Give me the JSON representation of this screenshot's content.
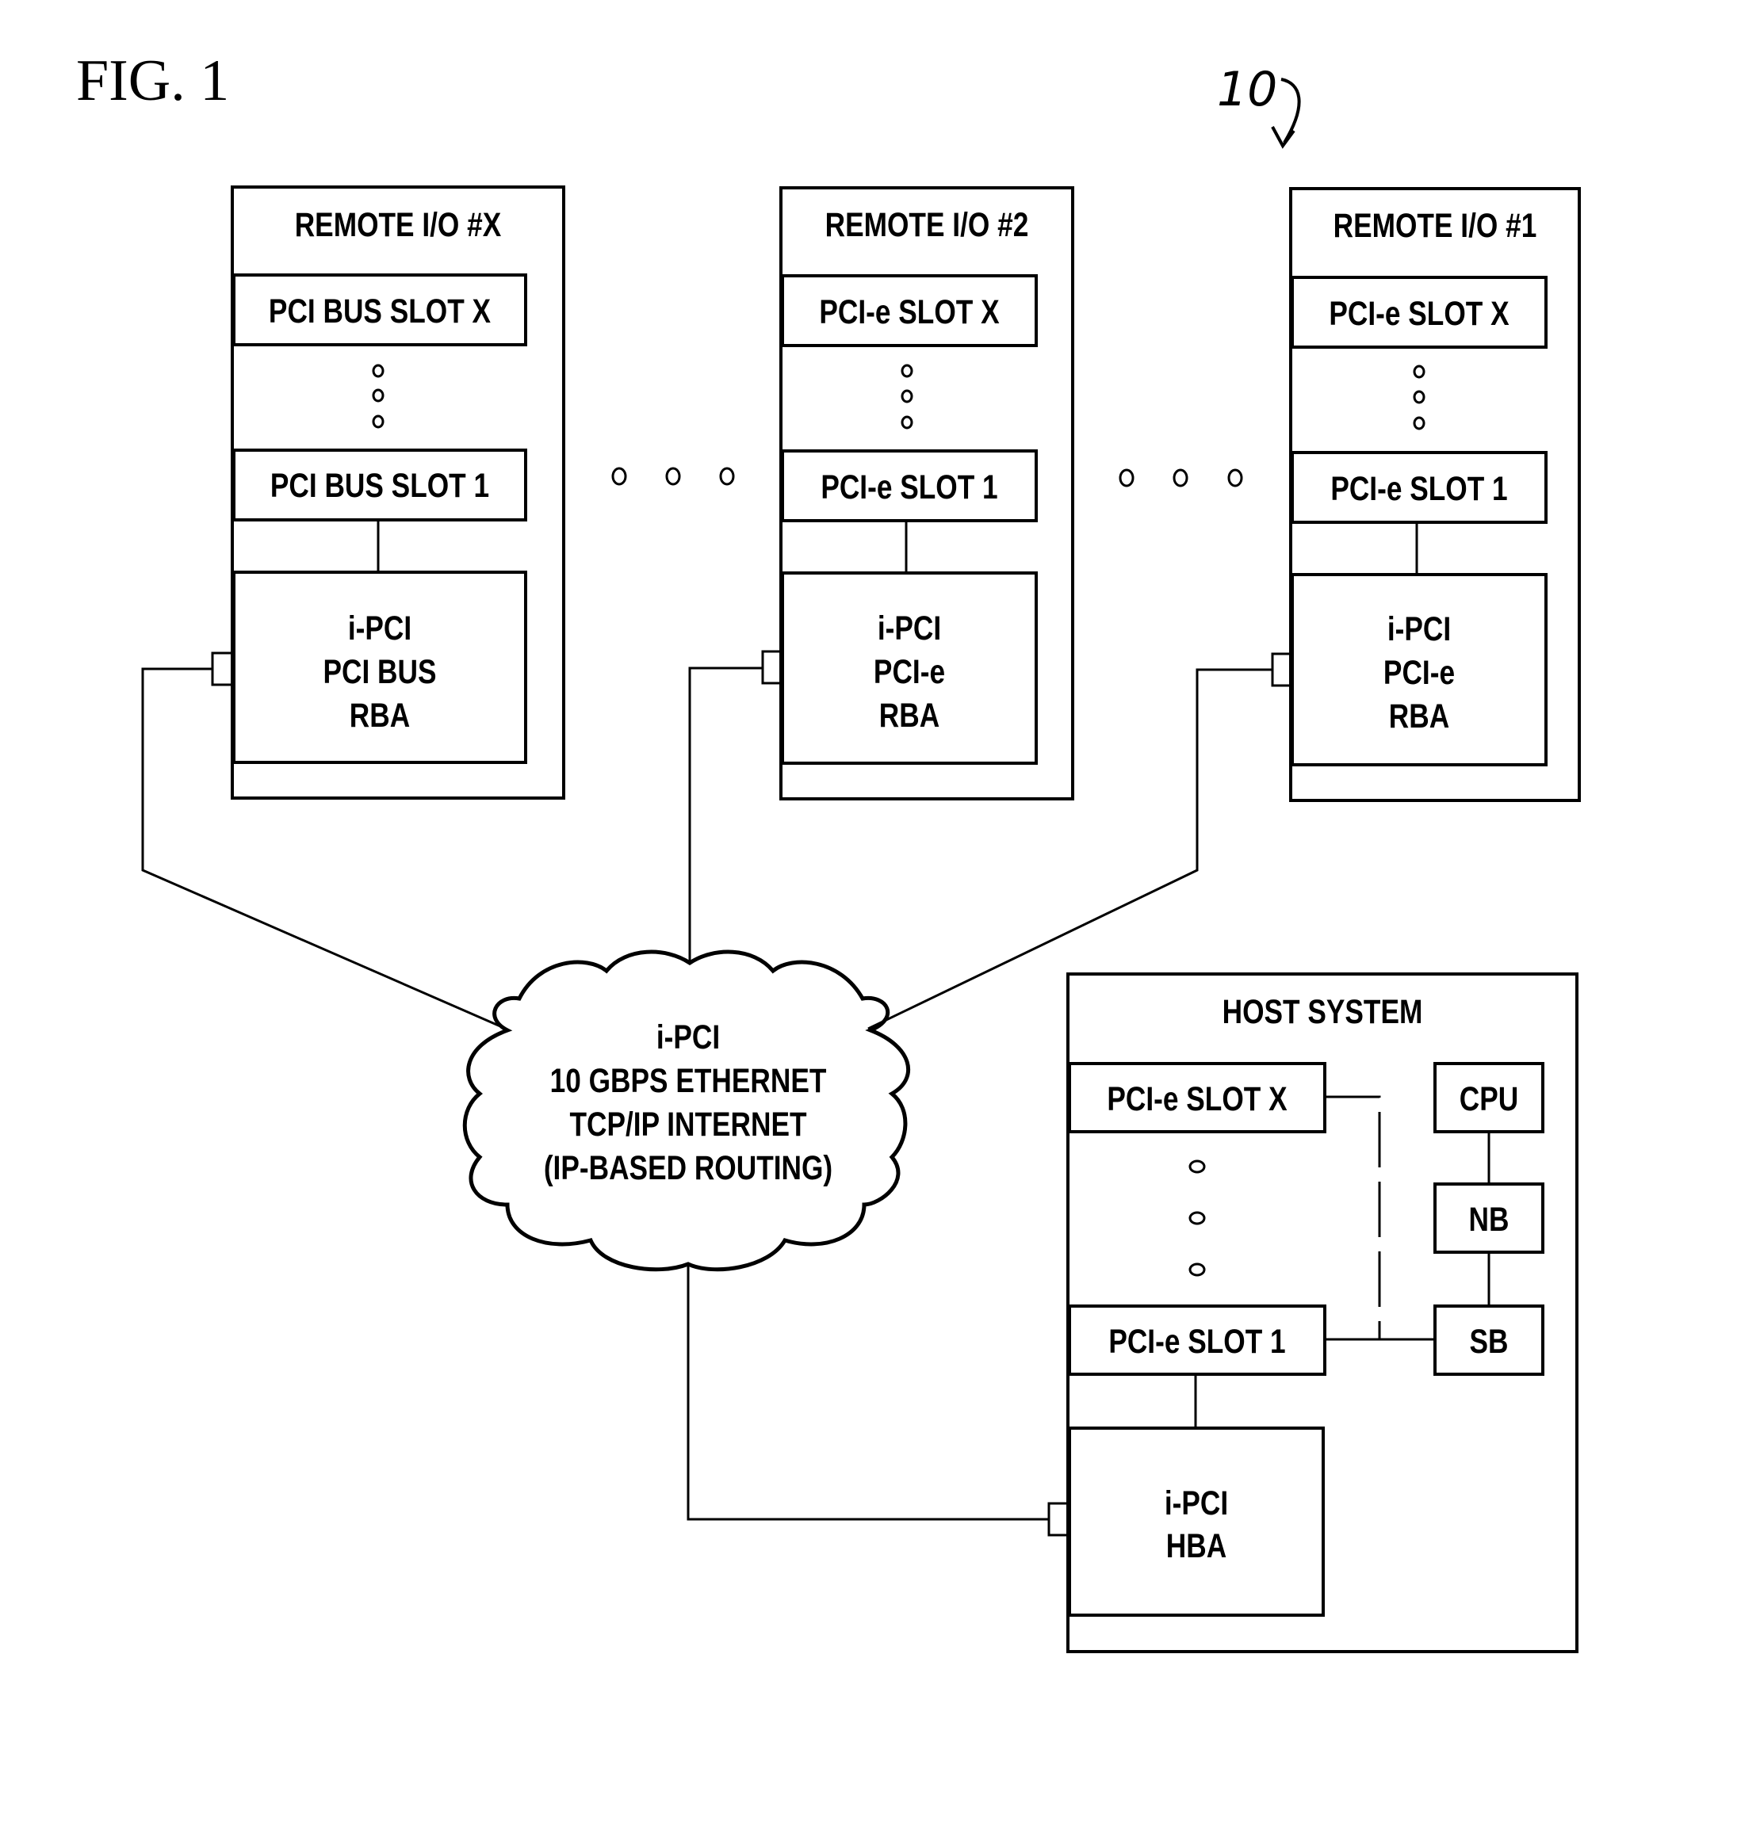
{
  "figure": {
    "label": "FIG. 1",
    "reference_numeral": "10"
  },
  "remote_units": [
    {
      "title": "REMOTE I/O #X",
      "slot_top": "PCI BUS SLOT X",
      "slot_bottom": "PCI BUS SLOT 1",
      "adapter": [
        "i-PCI",
        "PCI BUS",
        "RBA"
      ]
    },
    {
      "title": "REMOTE I/O #2",
      "slot_top": "PCI-e SLOT X",
      "slot_bottom": "PCI-e SLOT 1",
      "adapter": [
        "i-PCI",
        "PCI-e",
        "RBA"
      ]
    },
    {
      "title": "REMOTE I/O #1",
      "slot_top": "PCI-e SLOT X",
      "slot_bottom": "PCI-e SLOT 1",
      "adapter": [
        "i-PCI",
        "PCI-e",
        "RBA"
      ]
    }
  ],
  "network": {
    "lines": [
      "i-PCI",
      "10 GBPS ETHERNET",
      "TCP/IP INTERNET",
      "(IP-BASED ROUTING)"
    ]
  },
  "host": {
    "title": "HOST SYSTEM",
    "slot_top": "PCI-e SLOT X",
    "slot_bottom": "PCI-e SLOT 1",
    "adapter": [
      "i-PCI",
      "HBA"
    ],
    "cpu": "CPU",
    "nb": "NB",
    "sb": "SB"
  }
}
